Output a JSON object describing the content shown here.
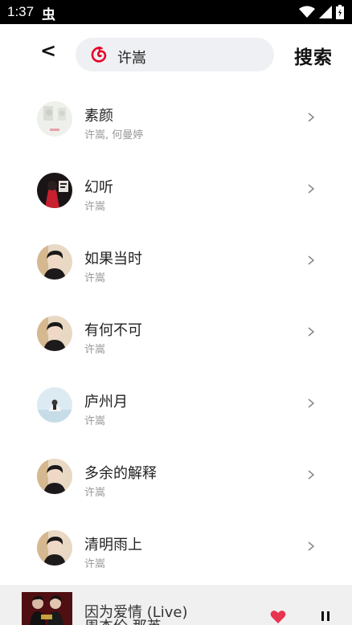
{
  "status_bar": {
    "time": "1:37",
    "notification_icon": "bug-icon",
    "notification_glyph": "虫",
    "icons": [
      "wifi-icon",
      "signal-icon",
      "battery-icon"
    ]
  },
  "header": {
    "back_label": "<",
    "search": {
      "logo_icon": "netease-music-icon",
      "value": "许嵩",
      "accent_color": "#e60026"
    },
    "search_button_label": "搜索"
  },
  "songs": [
    {
      "title": "素颜",
      "artist": "许嵩, 何曼婷",
      "cover": "light-cover"
    },
    {
      "title": "幻听",
      "artist": "许嵩",
      "cover": "red-cover"
    },
    {
      "title": "如果当时",
      "artist": "许嵩",
      "cover": "portrait-cover"
    },
    {
      "title": "有何不可",
      "artist": "许嵩",
      "cover": "portrait-cover"
    },
    {
      "title": "庐州月",
      "artist": "许嵩",
      "cover": "blue-cover"
    },
    {
      "title": "多余的解释",
      "artist": "许嵩",
      "cover": "portrait-cover"
    },
    {
      "title": "清明雨上",
      "artist": "许嵩",
      "cover": "portrait-cover"
    }
  ],
  "player": {
    "title": "因为爱情 (Live)",
    "artist": "周杰伦 那英",
    "liked": true,
    "heart_color": "#e8344e",
    "state": "playing"
  }
}
